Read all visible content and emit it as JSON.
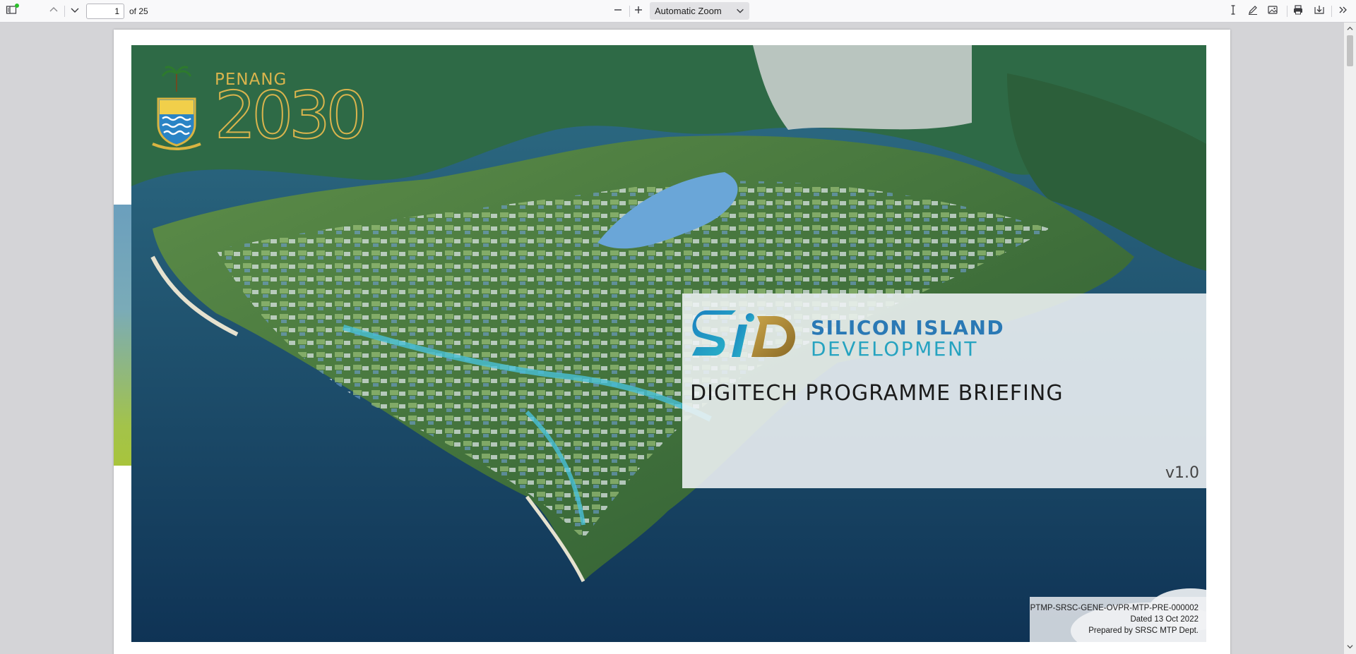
{
  "toolbar": {
    "sidebar_toggle_icon": "sidebar-toggle-icon",
    "prev_icon": "chevron-up-icon",
    "next_icon": "chevron-down-icon",
    "page_number": "1",
    "page_count_label": "of 25",
    "zoom_out_icon": "minus-icon",
    "zoom_in_icon": "plus-icon",
    "zoom_value": "Automatic Zoom",
    "text_tool_icon": "text-cursor-icon",
    "draw_tool_icon": "pen-icon",
    "image_tool_icon": "image-icon",
    "print_icon": "print-icon",
    "save_icon": "download-icon",
    "more_icon": "double-chevron-right-icon"
  },
  "document": {
    "logo_left_text": "PENANG",
    "logo_left_year": "2030",
    "brand_line_1": "SILICON ISLAND",
    "brand_line_2": "DEVELOPMENT",
    "brand_monogram": "SID",
    "title": "DIGITECH PROGRAMME BRIEFING",
    "version": "v1.0",
    "meta": {
      "reference": "PTMP-SRSC-GENE-OVPR-MTP-PRE-000002",
      "date": "Dated 13 Oct 2022",
      "prepared_by": "Prepared by SRSC MTP Dept."
    }
  },
  "colors": {
    "accent_bar_top": "#6b9fbd",
    "accent_bar_bottom": "#a8c43c",
    "brand_blue": "#2a79b5",
    "brand_teal": "#26a3c0",
    "gold": "#c9a43a"
  }
}
